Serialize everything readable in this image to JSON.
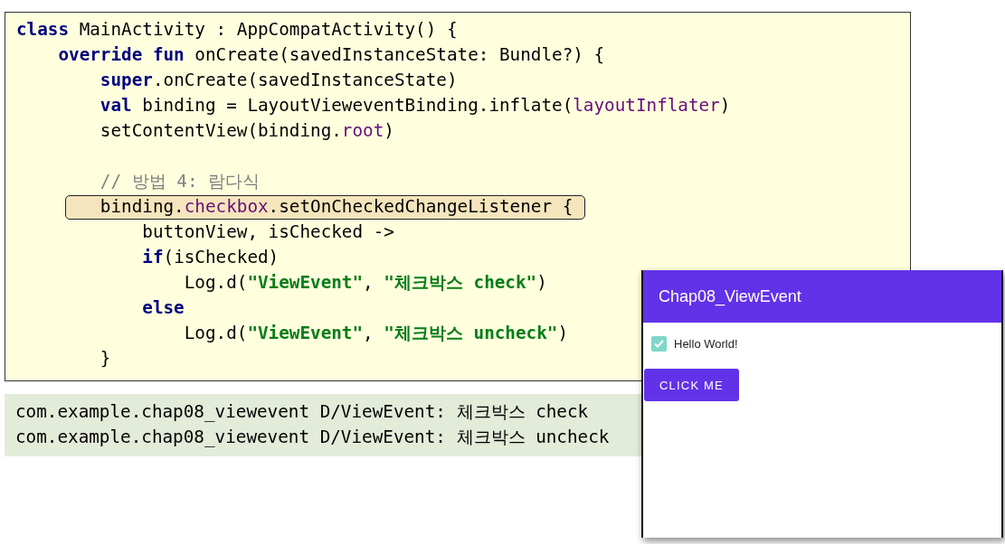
{
  "code_editor": {
    "lines": [
      {
        "kind": "code",
        "highlighted": false,
        "tokens": [
          {
            "kind": "keyword",
            "text": "class"
          },
          {
            "kind": "plain",
            "text": " MainActivity : AppCompatActivity() {"
          }
        ]
      },
      {
        "kind": "code",
        "highlighted": false,
        "tokens": [
          {
            "kind": "keyword",
            "text": "    override fun"
          },
          {
            "kind": "plain",
            "text": " onCreate(savedInstanceState: Bundle?) {"
          }
        ]
      },
      {
        "kind": "code",
        "highlighted": false,
        "tokens": [
          {
            "kind": "keyword",
            "text": "        super"
          },
          {
            "kind": "plain",
            "text": ".onCreate(savedInstanceState)"
          }
        ]
      },
      {
        "kind": "code",
        "highlighted": false,
        "tokens": [
          {
            "kind": "keyword",
            "text": "        val"
          },
          {
            "kind": "plain",
            "text": " binding = LayoutVieweventBinding.inflate("
          },
          {
            "kind": "property",
            "text": "layoutInflater"
          },
          {
            "kind": "plain",
            "text": ")"
          }
        ]
      },
      {
        "kind": "code",
        "highlighted": false,
        "tokens": [
          {
            "kind": "plain",
            "text": "        setContentView(binding."
          },
          {
            "kind": "property",
            "text": "root"
          },
          {
            "kind": "plain",
            "text": ")"
          }
        ]
      },
      {
        "kind": "blank"
      },
      {
        "kind": "code",
        "highlighted": false,
        "tokens": [
          {
            "kind": "comment",
            "text": "        // 방법 4: 람다식"
          }
        ]
      },
      {
        "kind": "code",
        "highlighted": true,
        "tokens": [
          {
            "kind": "plain",
            "text": "        binding."
          },
          {
            "kind": "property",
            "text": "checkbox"
          },
          {
            "kind": "plain",
            "text": ".setOnCheckedChangeListener {"
          }
        ]
      },
      {
        "kind": "code",
        "highlighted": false,
        "tokens": [
          {
            "kind": "plain",
            "text": "            buttonView, isChecked ->"
          }
        ]
      },
      {
        "kind": "code",
        "highlighted": false,
        "tokens": [
          {
            "kind": "keyword",
            "text": "            if"
          },
          {
            "kind": "plain",
            "text": "(isChecked)"
          }
        ]
      },
      {
        "kind": "code",
        "highlighted": false,
        "tokens": [
          {
            "kind": "plain",
            "text": "                Log.d("
          },
          {
            "kind": "string",
            "text": "\"ViewEvent\""
          },
          {
            "kind": "plain",
            "text": ", "
          },
          {
            "kind": "string",
            "text": "\"체크박스 check\""
          },
          {
            "kind": "plain",
            "text": ")"
          }
        ]
      },
      {
        "kind": "code",
        "highlighted": false,
        "tokens": [
          {
            "kind": "keyword",
            "text": "            else"
          }
        ]
      },
      {
        "kind": "code",
        "highlighted": false,
        "tokens": [
          {
            "kind": "plain",
            "text": "                Log.d("
          },
          {
            "kind": "string",
            "text": "\"ViewEvent\""
          },
          {
            "kind": "plain",
            "text": ", "
          },
          {
            "kind": "string",
            "text": "\"체크박스 uncheck\""
          },
          {
            "kind": "plain",
            "text": ")"
          }
        ]
      },
      {
        "kind": "code",
        "highlighted": false,
        "tokens": [
          {
            "kind": "plain",
            "text": "        }"
          }
        ]
      }
    ]
  },
  "log_output": {
    "lines": [
      "com.example.chap08_viewevent D/ViewEvent: 체크박스 check",
      "com.example.chap08_viewevent D/ViewEvent: 체크박스 uncheck"
    ]
  },
  "phone": {
    "app_bar": {
      "title": "Chap08_ViewEvent"
    },
    "checkbox": {
      "label": "Hello World!",
      "checked": true
    },
    "button": {
      "label": "CLICK ME"
    }
  }
}
